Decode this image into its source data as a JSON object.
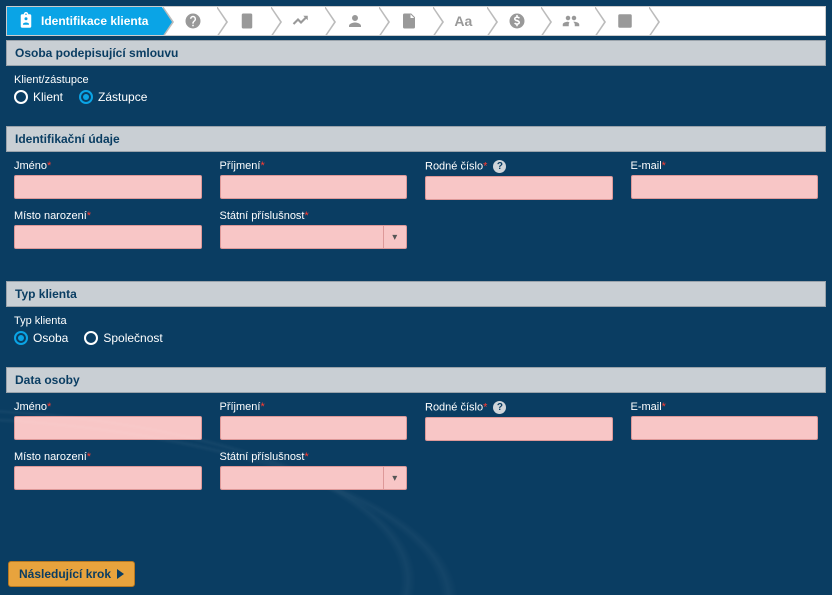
{
  "stepper": {
    "active_label": "Identifikace klienta"
  },
  "sections": {
    "osoba": {
      "title": "Osoba podepisující smlouvu",
      "group_label": "Klient/zástupce",
      "opt1": "Klient",
      "opt2": "Zástupce"
    },
    "ident": {
      "title": "Identifikační údaje",
      "jmeno": "Jméno",
      "prijmeni": "Příjmení",
      "rodne": "Rodné číslo",
      "email": "E-mail",
      "misto": "Místo narození",
      "statni": "Státní příslušnost"
    },
    "typ": {
      "title": "Typ klienta",
      "group_label": "Typ klienta",
      "opt1": "Osoba",
      "opt2": "Společnost"
    },
    "data_osoby": {
      "title": "Data osoby",
      "jmeno": "Jméno",
      "prijmeni": "Příjmení",
      "rodne": "Rodné číslo",
      "email": "E-mail",
      "misto": "Místo narození",
      "statni": "Státní příslušnost"
    }
  },
  "next_button": "Následující krok"
}
